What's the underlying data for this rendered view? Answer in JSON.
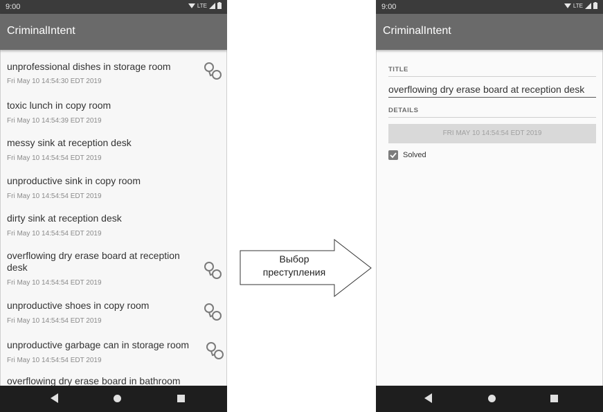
{
  "list_screen": {
    "status_time": "9:00",
    "status_network": "LTE",
    "app_title": "CriminalIntent",
    "crimes": [
      {
        "title": "unprofessional dishes in storage room",
        "date": "Fri May 10 14:54:30 EDT 2019",
        "solved": true
      },
      {
        "title": "toxic lunch in copy room",
        "date": "Fri May 10 14:54:39 EDT 2019",
        "solved": false
      },
      {
        "title": "messy sink at reception desk",
        "date": "Fri May 10 14:54:54 EDT 2019",
        "solved": false
      },
      {
        "title": "unproductive sink in copy room",
        "date": "Fri May 10 14:54:54 EDT 2019",
        "solved": false
      },
      {
        "title": "dirty sink at reception desk",
        "date": "Fri May 10 14:54:54 EDT 2019",
        "solved": false
      },
      {
        "title": "overflowing dry erase board at reception desk",
        "date": "Fri May 10 14:54:54 EDT 2019",
        "solved": true
      },
      {
        "title": "unproductive shoes in copy room",
        "date": "Fri May 10 14:54:54 EDT 2019",
        "solved": true
      },
      {
        "title": "unproductive garbage can in storage room",
        "date": "Fri May 10 14:54:54 EDT 2019",
        "solved": true
      },
      {
        "title": "overflowing dry erase board in bathroom",
        "date": "",
        "solved": false
      }
    ],
    "nav_icons": [
      "back-icon",
      "home-icon",
      "recents-icon"
    ]
  },
  "arrow": {
    "line1": "Выбор",
    "line2": "преступления"
  },
  "detail_screen": {
    "status_time": "9:00",
    "status_network": "LTE",
    "app_title": "CriminalIntent",
    "title_label": "TITLE",
    "title_value": "overflowing dry erase board at reception desk",
    "details_label": "DETAILS",
    "date_button": "FRI MAY 10 14:54:54 EDT 2019",
    "solved_label": "Solved",
    "solved_checked": true
  },
  "colors": {
    "app_bar": "#6a6a6a",
    "status_bar": "#3b3b3b",
    "nav_bar": "#1e1e1e",
    "list_bg": "#f7f7f7"
  }
}
